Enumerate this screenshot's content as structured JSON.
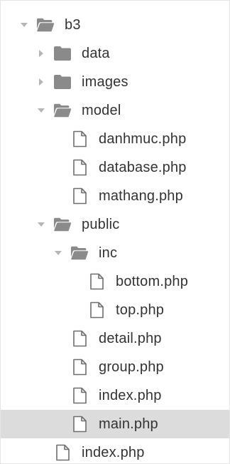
{
  "tree": {
    "items": [
      {
        "label": "b3",
        "kind": "folder",
        "expanded": true,
        "depth": 0
      },
      {
        "label": "data",
        "kind": "folder",
        "expanded": false,
        "depth": 1
      },
      {
        "label": "images",
        "kind": "folder",
        "expanded": false,
        "depth": 1
      },
      {
        "label": "model",
        "kind": "folder",
        "expanded": true,
        "depth": 1
      },
      {
        "label": "danhmuc.php",
        "kind": "file",
        "depth": 2
      },
      {
        "label": "database.php",
        "kind": "file",
        "depth": 2
      },
      {
        "label": "mathang.php",
        "kind": "file",
        "depth": 2
      },
      {
        "label": "public",
        "kind": "folder",
        "expanded": true,
        "depth": 1
      },
      {
        "label": "inc",
        "kind": "folder",
        "expanded": true,
        "depth": 2
      },
      {
        "label": "bottom.php",
        "kind": "file",
        "depth": 3
      },
      {
        "label": "top.php",
        "kind": "file",
        "depth": 3
      },
      {
        "label": "detail.php",
        "kind": "file",
        "depth": 2
      },
      {
        "label": "group.php",
        "kind": "file",
        "depth": 2
      },
      {
        "label": "index.php",
        "kind": "file",
        "depth": 2
      },
      {
        "label": "main.php",
        "kind": "file",
        "depth": 2,
        "selected": true
      },
      {
        "label": "index.php",
        "kind": "file",
        "depth": 1
      }
    ]
  },
  "icons": {
    "expanded": "chevron-down-icon",
    "collapsed": "chevron-right-icon",
    "folder_closed": "folder-closed-icon",
    "folder_open": "folder-open-icon",
    "file": "file-icon"
  },
  "colors": {
    "text": "#333333",
    "icon": "#8a8a8a",
    "chevron": "#b5b5b5",
    "selected_bg": "#dcdcdc"
  }
}
